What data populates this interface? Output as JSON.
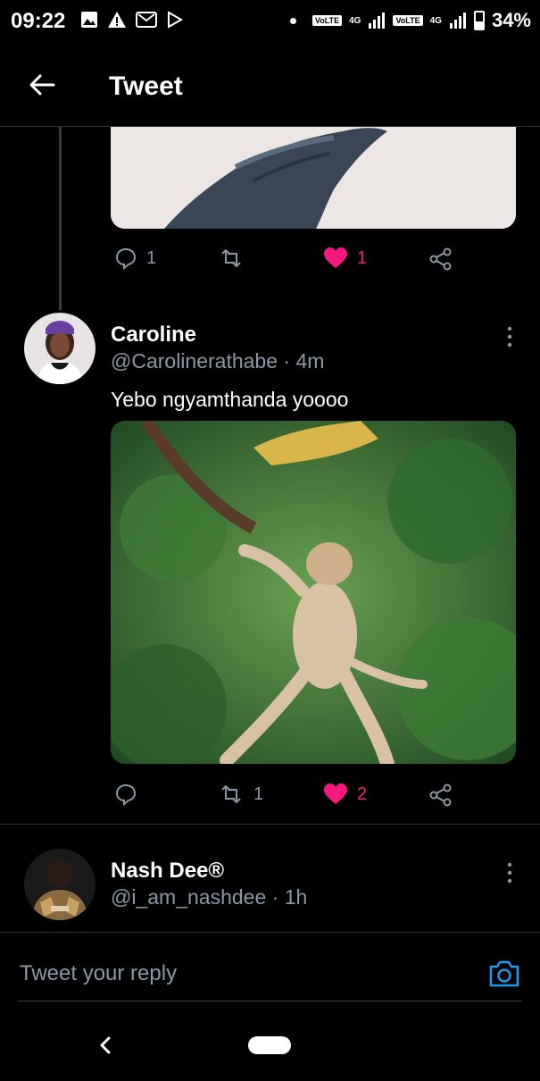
{
  "status_bar": {
    "time": "09:22",
    "volte1": "VoLTE",
    "net1": "4G",
    "volte2": "VoLTE",
    "net2": "4G",
    "battery": "34%"
  },
  "header": {
    "title": "Tweet"
  },
  "tweet1_actions": {
    "replies": "1",
    "retweets": "",
    "likes": "1"
  },
  "tweet2": {
    "name": "Caroline",
    "handle": "@Carolinerathabe",
    "time": "4m",
    "text": "Yebo ngyamthanda yoooo",
    "replies": "",
    "retweets": "1",
    "likes": "2"
  },
  "tweet3": {
    "name": "Nash Dee®",
    "handle": "@i_am_nashdee",
    "time": "1h"
  },
  "reply_bar": {
    "placeholder": "Tweet your reply"
  },
  "colors": {
    "like": "#f91880",
    "muted": "#8b98a5",
    "accent": "#1d9bf0"
  }
}
